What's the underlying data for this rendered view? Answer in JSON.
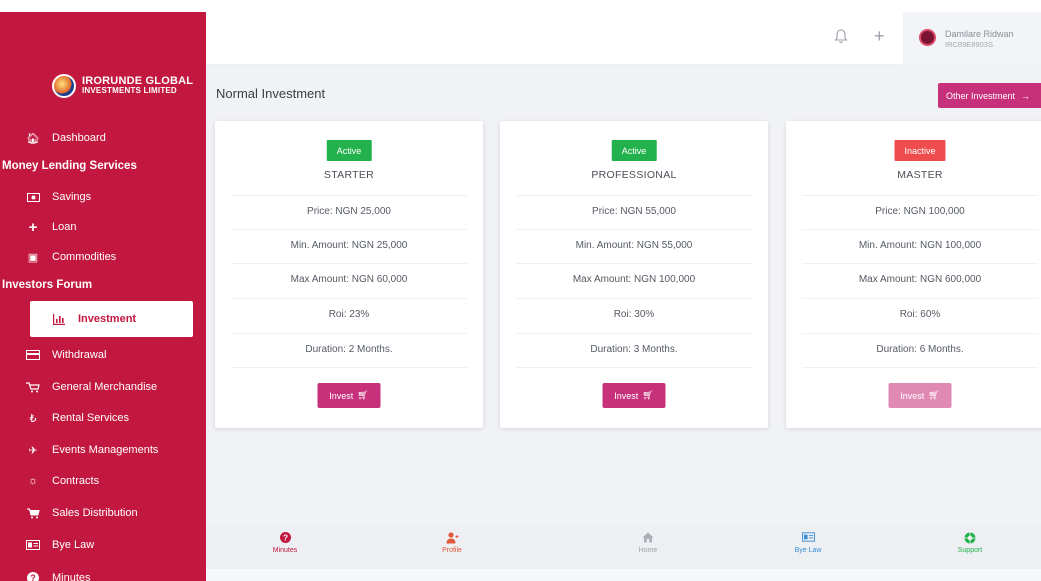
{
  "brand": {
    "line1": "IRORUNDE GLOBAL",
    "line2": "INVESTMENTS LIMITED"
  },
  "sidebar": {
    "items": [
      {
        "label": "Dashboard",
        "icon": "home-icon"
      },
      {
        "label": "Money Lending Services",
        "heading": true
      },
      {
        "label": "Savings",
        "icon": "money-icon"
      },
      {
        "label": "Loan",
        "icon": "plus-icon"
      },
      {
        "label": "Commodities",
        "icon": "cubes-icon"
      },
      {
        "label": "Investors Forum",
        "heading": true
      },
      {
        "label": "Investment",
        "icon": "bar-chart-icon",
        "active": true
      },
      {
        "label": "Withdrawal",
        "icon": "credit-card-icon"
      },
      {
        "label": "General Merchandise",
        "icon": "cart-icon"
      },
      {
        "label": "Rental Services",
        "icon": "rental-icon"
      },
      {
        "label": "Events Managements",
        "icon": "plane-icon"
      },
      {
        "label": "Contracts",
        "icon": "handshake-icon"
      },
      {
        "label": "Sales Distribution",
        "icon": "shopping-cart-icon"
      },
      {
        "label": "Bye Law",
        "icon": "id-card-icon"
      },
      {
        "label": "Minutes",
        "icon": "question-icon"
      }
    ]
  },
  "topbar": {
    "user_name": "Damilare Ridwan",
    "user_id": "IRC89E8903S"
  },
  "main": {
    "title": "Normal Investment",
    "other_button": "Other Investment",
    "plans": [
      {
        "status": "Active",
        "active": true,
        "name": "STARTER",
        "price": "Price: NGN 25,000",
        "min": "Min. Amount: NGN 25,000",
        "max": "Max Amount: NGN 60,000",
        "roi": "Roi: 23%",
        "duration": "Duration: 2 Months.",
        "button": "Invest"
      },
      {
        "status": "Active",
        "active": true,
        "name": "PROFESSIONAL",
        "price": "Price: NGN 55,000",
        "min": "Min. Amount: NGN 55,000",
        "max": "Max Amount: NGN 100,000",
        "roi": "Roi: 30%",
        "duration": "Duration: 3 Months.",
        "button": "Invest"
      },
      {
        "status": "Inactive",
        "active": false,
        "name": "MASTER",
        "price": "Price: NGN 100,000",
        "min": "Min. Amount: NGN 100,000",
        "max": "Max Amount: NGN 600,000",
        "roi": "Roi: 60%",
        "duration": "Duration: 6 Months.",
        "button": "Invest"
      }
    ]
  },
  "bottom_nav": [
    {
      "label": "Minutes",
      "icon": "question-icon",
      "color": "#c2183f"
    },
    {
      "label": "Profile",
      "icon": "user-icon",
      "color": "#e05a3a"
    },
    {
      "label": "Home",
      "icon": "home-icon",
      "color": "#9aa0a8"
    },
    {
      "label": "Bye Law",
      "icon": "id-card-icon",
      "color": "#3b8fd9"
    },
    {
      "label": "Support",
      "icon": "support-icon",
      "color": "#22b14c"
    }
  ],
  "colors": {
    "sidebar": "#c2183f",
    "accent": "#c7307a",
    "active_badge": "#22b14c",
    "inactive_badge": "#ef4d4d"
  }
}
